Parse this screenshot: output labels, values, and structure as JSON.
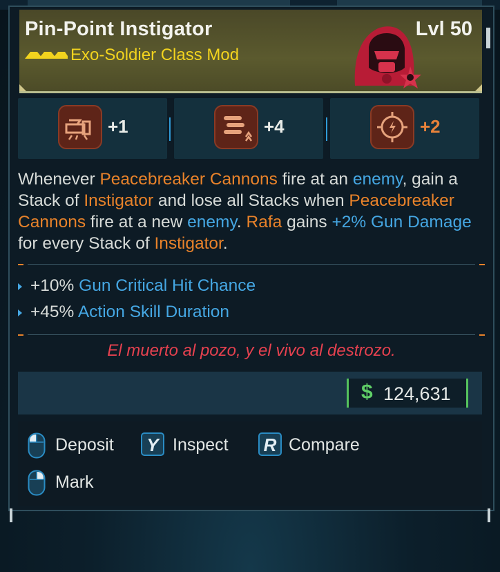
{
  "item": {
    "name": "Pin-Point Instigator",
    "level": "Lvl 50",
    "type": "Exo-Soldier Class Mod",
    "rarity_color": "#f2d31e",
    "portrait_icon": "hooded-soldier-icon"
  },
  "skills": [
    {
      "icon": "cannon-icon",
      "value": "+1"
    },
    {
      "icon": "bullets-icon",
      "value": "+4"
    },
    {
      "icon": "crosshair-icon",
      "value": "+2"
    }
  ],
  "description": {
    "p1": "Whenever ",
    "t1": "Peacebreaker Cannons",
    "p2": " fire at an ",
    "t2": "enemy",
    "p3": ", gain a Stack of ",
    "t3": "Instigator",
    "p4": " and lose all Stacks when ",
    "t4": "Peacebreaker Cannons",
    "p5": " fire at a new ",
    "t5": "enemy",
    "p6": ". ",
    "t6": "Rafa",
    "p7": " gains ",
    "t7": "+2% Gun Damage",
    "p8": " for every Stack of ",
    "t8": "Instigator",
    "p9": "."
  },
  "stats": [
    {
      "value": "+10%",
      "name": "Gun Critical Hit Chance"
    },
    {
      "value": "+45%",
      "name": "Action Skill Duration"
    }
  ],
  "flavor_text": "El muerto al pozo, y el vivo al destrozo.",
  "price": {
    "symbol": "$",
    "value": "124,631"
  },
  "actions": [
    {
      "key": "mouse-icon",
      "label": "Deposit"
    },
    {
      "key": "Y",
      "label": "Inspect"
    },
    {
      "key": "R",
      "label": "Compare"
    },
    {
      "key": "mouse-icon",
      "label": "Mark"
    }
  ],
  "colors": {
    "orange": "#e8822a",
    "blue": "#45a7e3",
    "flavor_red": "#e5414f",
    "price_green": "#5fcf67"
  }
}
